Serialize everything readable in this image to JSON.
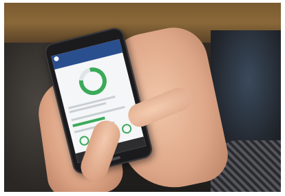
{
  "scene": {
    "description_icon": "smartphone-in-hands"
  },
  "phone_app": {
    "header_logo": "hp",
    "colors": {
      "header": "#2a4f8f",
      "accent_green": "#3aaa5a"
    },
    "gauge_level_percent": 80,
    "progress_bar_percent": 60
  }
}
